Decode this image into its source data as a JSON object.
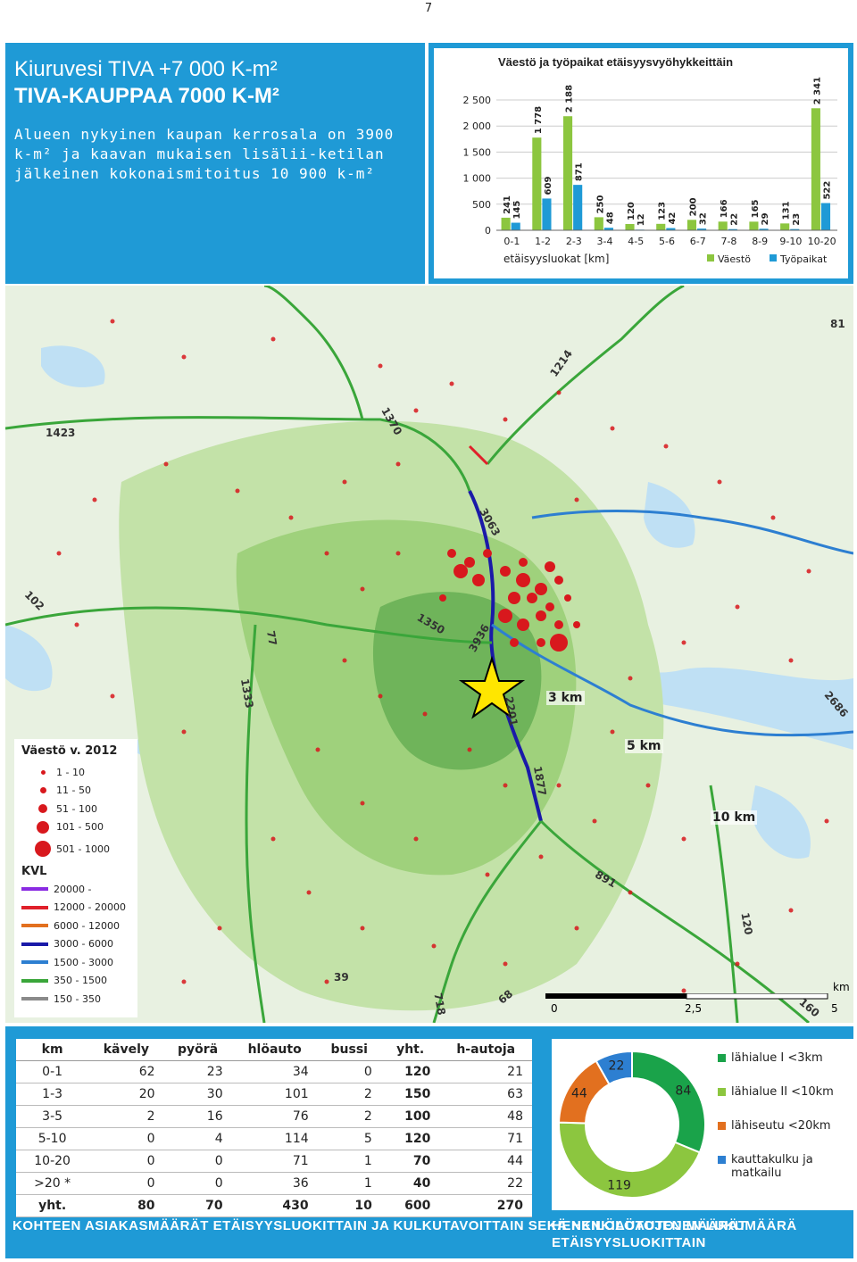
{
  "page_number": "7",
  "header": {
    "title_line1": "Kiuruvesi TIVA +7 000 K-m²",
    "title_line2": "TIVA-KAUPPAA 7000 K-M²",
    "description": "Alueen nykyinen kaupan kerrosala on 3900 k-m² ja kaavan mukaisen lisälii-ketilan jälkeinen kokonaismitoitus 10 900 k-m²"
  },
  "chart_data": {
    "type": "bar",
    "title": "Väestö ja työpaikat etäisyysvyöhykkeittäin",
    "xlabel": "etäisyysluokat [km]",
    "ylabel": "",
    "ylim": [
      0,
      2500
    ],
    "yticks": [
      "0",
      "500",
      "1 000",
      "1 500",
      "2 000",
      "2 500"
    ],
    "categories": [
      "0-1",
      "1-2",
      "2-3",
      "3-4",
      "4-5",
      "5-6",
      "6-7",
      "7-8",
      "8-9",
      "9-10",
      "10-20"
    ],
    "series": [
      {
        "name": "Väestö",
        "color": "#8cc63f",
        "values": [
          241,
          1778,
          2188,
          250,
          120,
          123,
          200,
          166,
          165,
          131,
          2341
        ],
        "labels": [
          "241",
          "1 778",
          "2 188",
          "250",
          "120",
          "123",
          "200",
          "166",
          "165",
          "131",
          "2 341"
        ]
      },
      {
        "name": "Työpaikat",
        "color": "#1f9ad6",
        "values": [
          145,
          609,
          871,
          48,
          12,
          42,
          32,
          22,
          29,
          23,
          522
        ],
        "labels": [
          "145",
          "609",
          "871",
          "48",
          "12",
          "42",
          "32",
          "22",
          "29",
          "23",
          "522"
        ]
      }
    ],
    "legend_position": "bottom-right",
    "grid": true
  },
  "map": {
    "legend_title": "Väestö v. 2012",
    "population_classes": [
      "1 - 10",
      "11 - 50",
      "51 - 100",
      "101 - 500",
      "501 - 1000"
    ],
    "kvl_title": "KVL",
    "kvl_classes": [
      {
        "label": "20000 -",
        "color": "#8a2be2"
      },
      {
        "label": "12000 - 20000",
        "color": "#e0202a"
      },
      {
        "label": "6000 - 12000",
        "color": "#e2701f"
      },
      {
        "label": "3000 - 6000",
        "color": "#1a1aa8"
      },
      {
        "label": "1500 - 3000",
        "color": "#2d7fd1"
      },
      {
        "label": "350 - 1500",
        "color": "#3aa63a"
      },
      {
        "label": "150 - 350",
        "color": "#8a8a8a"
      }
    ],
    "rings": [
      "3 km",
      "5 km",
      "10 km"
    ],
    "road_counts": [
      "1423",
      "1370",
      "3063",
      "1350",
      "3936",
      "2201",
      "1877",
      "891",
      "120",
      "39",
      "718",
      "68",
      "160",
      "102",
      "77",
      "1333",
      "2686",
      "81",
      "1214"
    ],
    "scale": {
      "labels": [
        "0",
        "2,5",
        "5"
      ],
      "unit": "km"
    }
  },
  "table": {
    "headers": [
      "km",
      "kävely",
      "pyörä",
      "hlöauto",
      "bussi",
      "yht.",
      "h-autoja"
    ],
    "rows": [
      [
        "0-1",
        "62",
        "23",
        "34",
        "0",
        "120",
        "21"
      ],
      [
        "1-3",
        "20",
        "30",
        "101",
        "2",
        "150",
        "63"
      ],
      [
        "3-5",
        "2",
        "16",
        "76",
        "2",
        "100",
        "48"
      ],
      [
        "5-10",
        "0",
        "4",
        "114",
        "5",
        "120",
        "71"
      ],
      [
        "10-20",
        "0",
        "0",
        "71",
        "1",
        "70",
        "44"
      ],
      [
        ">20 *",
        "0",
        "0",
        "36",
        "1",
        "40",
        "22"
      ],
      [
        "yht.",
        "80",
        "70",
        "430",
        "10",
        "600",
        "270"
      ]
    ],
    "caption": "KOHTEEN ASIAKASMÄÄRÄT ETÄISYYSLUOKITTAIN JA KULKUTAVOITTAIN SEKÄ HENKILÖAUTOJEN LUKUMÄÄRÄ"
  },
  "donut": {
    "segments": [
      {
        "label": "lähialue I <3km",
        "value": 84,
        "color": "#1aa34a"
      },
      {
        "label": "lähialue II <10km",
        "value": 119,
        "color": "#8cc63f"
      },
      {
        "label": "lähiseutu <20km",
        "value": 44,
        "color": "#e2701f"
      },
      {
        "label": "kauttakulku ja matkailu",
        "value": 22,
        "color": "#2d7fd1"
      }
    ],
    "caption": "HENKILÖAUTOJEN MÄÄRÄT ETÄISYYSLUOKITTAIN"
  }
}
